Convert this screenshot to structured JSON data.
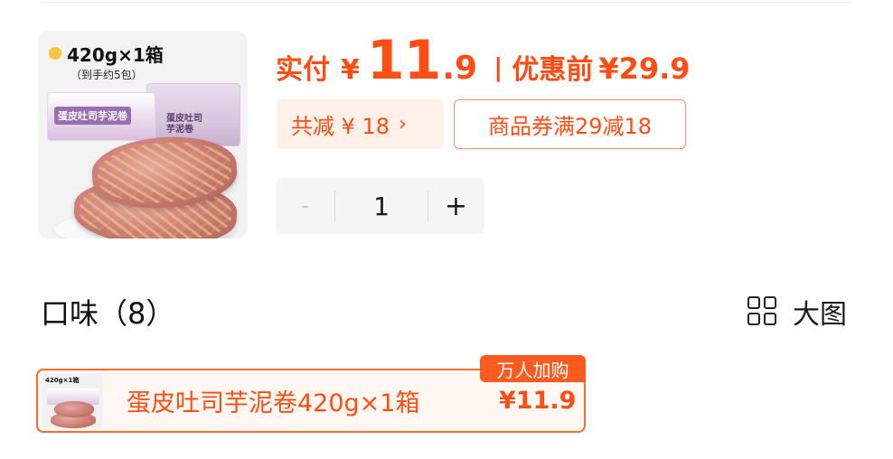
{
  "product": {
    "image": {
      "spec": "420g×1箱",
      "spec_sub": "（到手约5包）",
      "pkg_front_label": "蛋皮吐司芋泥卷",
      "pkg_back_label": "蛋皮吐司芋泥卷"
    },
    "price": {
      "pay_label": "实付",
      "currency": "¥",
      "pay_int": "11",
      "pay_dec": ".9",
      "separator": "|",
      "orig_label": "优惠前",
      "orig_price": "¥29.9"
    },
    "discount": {
      "total_label": "共减 ¥ 18",
      "chevron": "›",
      "coupon_label": "商品券满29减18"
    },
    "stepper": {
      "minus": "-",
      "quantity": "1",
      "plus": "+"
    }
  },
  "flavor": {
    "title": "口味（8）",
    "view_icon": "grid-icon",
    "view_label": "大图",
    "options": [
      {
        "thumb_spec": "420g×1箱",
        "name": "蛋皮吐司芋泥卷420g×1箱",
        "price": "¥11.9",
        "badge": "万人加购",
        "selected": true
      }
    ]
  },
  "colors": {
    "accent": "#ff4d14",
    "accent_light": "#fff1ea",
    "badge_bg": "#ff5a1f",
    "stepper_bg": "#f5f5f5"
  }
}
